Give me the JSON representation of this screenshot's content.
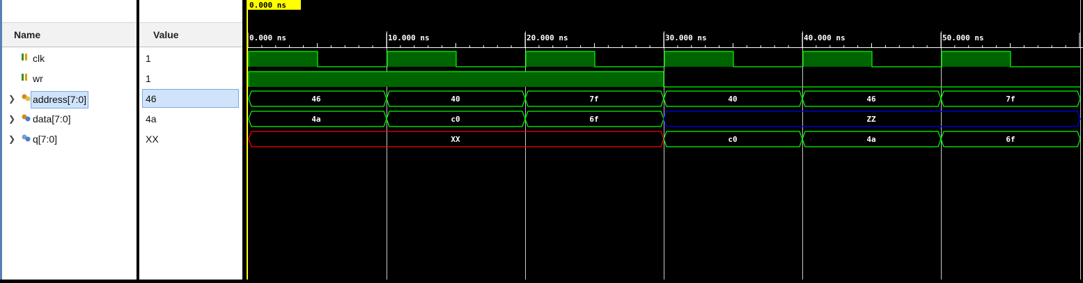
{
  "columns": {
    "name": "Name",
    "value": "Value"
  },
  "cursor": {
    "label": "0.000 ns"
  },
  "ruler": {
    "ticks": [
      "0.000 ns",
      "10.000 ns",
      "20.000 ns",
      "30.000 ns",
      "40.000 ns",
      "50.000 ns"
    ]
  },
  "signals": [
    {
      "name": "clk",
      "value": "1",
      "kind": "bit",
      "expandable": false,
      "selected": false
    },
    {
      "name": "wr",
      "value": "1",
      "kind": "bit",
      "expandable": false,
      "selected": false
    },
    {
      "name": "address[7:0]",
      "value": "46",
      "kind": "bus",
      "expandable": true,
      "selected": true,
      "segments": [
        "46",
        "40",
        "7f",
        "40",
        "46",
        "7f"
      ]
    },
    {
      "name": "data[7:0]",
      "value": "4a",
      "kind": "bus",
      "expandable": true,
      "selected": false,
      "segments": [
        "4a",
        "c0",
        "6f",
        "ZZ"
      ]
    },
    {
      "name": "q[7:0]",
      "value": "XX",
      "kind": "bus",
      "expandable": true,
      "selected": false,
      "segments": [
        "XX",
        "c0",
        "4a",
        "6f"
      ]
    }
  ],
  "colors": {
    "wave": "#00ff00",
    "fill": "#006400",
    "undefined": "#ff0000",
    "highz": "#0000cc",
    "cursor": "#ffff00",
    "grid": "#ffffff"
  }
}
